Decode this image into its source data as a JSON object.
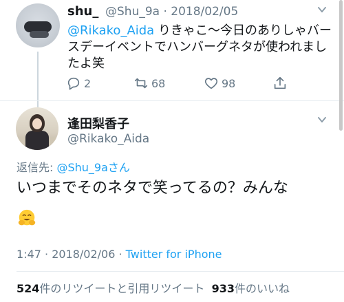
{
  "parent_tweet": {
    "name": "shu_",
    "handle_date": "@Shu_9a · 2018/02/05",
    "mention": "@Rikako_Aida",
    "text_after_mention": " りきゃこ〜今日のありしゃバースデーイベントでハンバーグネタが使われましたよ笑",
    "reply_count": "2",
    "retweet_count": "68",
    "like_count": "98"
  },
  "main_tweet": {
    "name": "逢田梨香子",
    "handle": "@Rikako_Aida",
    "reply_to_label": "返信先: ",
    "reply_to_mention": "@Shu_9a",
    "reply_to_suffix": "さん",
    "text": "いつまでそのネタで笑ってるの？みんな",
    "emoji_icon": "hugging-face-icon",
    "time_date": "1:47 · 2018/02/06 · ",
    "via": "Twitter for iPhone",
    "retweet_count": "524",
    "retweet_label": "件のリツイートと引用リツイート",
    "like_count": "933",
    "like_label": "件のいいね"
  },
  "colors": {
    "accent": "#1da1f2",
    "muted": "#657786",
    "text": "#14171a"
  }
}
